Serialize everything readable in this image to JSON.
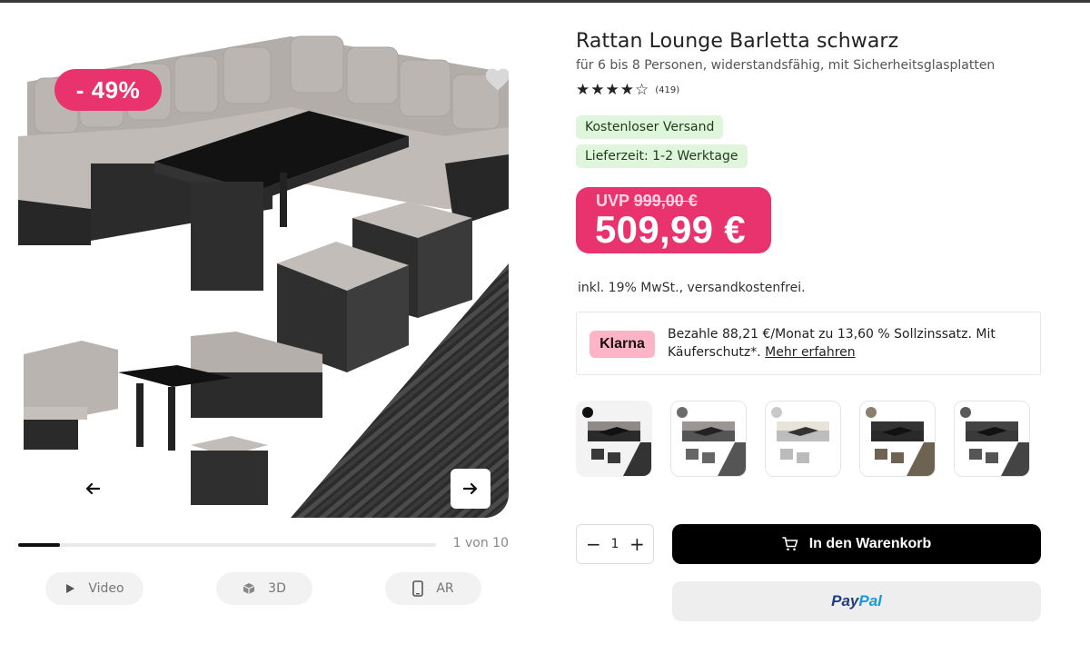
{
  "gallery": {
    "discount_badge": "- 49%",
    "counter": "1 von 10",
    "progress": 0.1,
    "media_buttons": [
      {
        "label": "Video",
        "icon": "play-icon"
      },
      {
        "label": "3D",
        "icon": "cube-icon"
      },
      {
        "label": "AR",
        "icon": "phone-icon"
      }
    ]
  },
  "product": {
    "title": "Rattan Lounge Barletta schwarz",
    "subtitle": "für 6 bis 8 Personen, widerstandsfähig, mit Sicherheitsglasplatten",
    "rating": {
      "stars": "★★★★☆",
      "value": 4,
      "count": "(419)"
    },
    "tags": [
      "Kostenloser Versand",
      "Lieferzeit: 1-2 Werktage"
    ],
    "price": {
      "uvp_label": "UVP",
      "uvp_value": "999,00 €",
      "current": "509,99 €"
    },
    "vat_note": "inkl. 19% MwSt., versandkostenfrei.",
    "klarna": {
      "logo": "Klarna",
      "text": "Bezahle 88,21 €/Monat zu 13,60 % Sollzinssatz. Mit Käuferschutz*.",
      "link": "Mehr erfahren"
    },
    "variants": [
      {
        "color": "#111111",
        "selected": true
      },
      {
        "color": "#6b6b6b",
        "selected": false
      },
      {
        "color": "#c9c9c9",
        "selected": false
      },
      {
        "color": "#8a8070",
        "selected": false
      },
      {
        "color": "#5a5a5a",
        "selected": false
      }
    ],
    "quantity": {
      "minus": "−",
      "value": "1",
      "plus": "+"
    },
    "cart_button": "In den Warenkorb",
    "paypal": {
      "part1": "Pay",
      "part2": "Pal"
    }
  },
  "colors": {
    "accent_pink": "#e8336f",
    "tag_green_bg": "#dff6dc",
    "klarna_pink": "#ffb3c7"
  }
}
